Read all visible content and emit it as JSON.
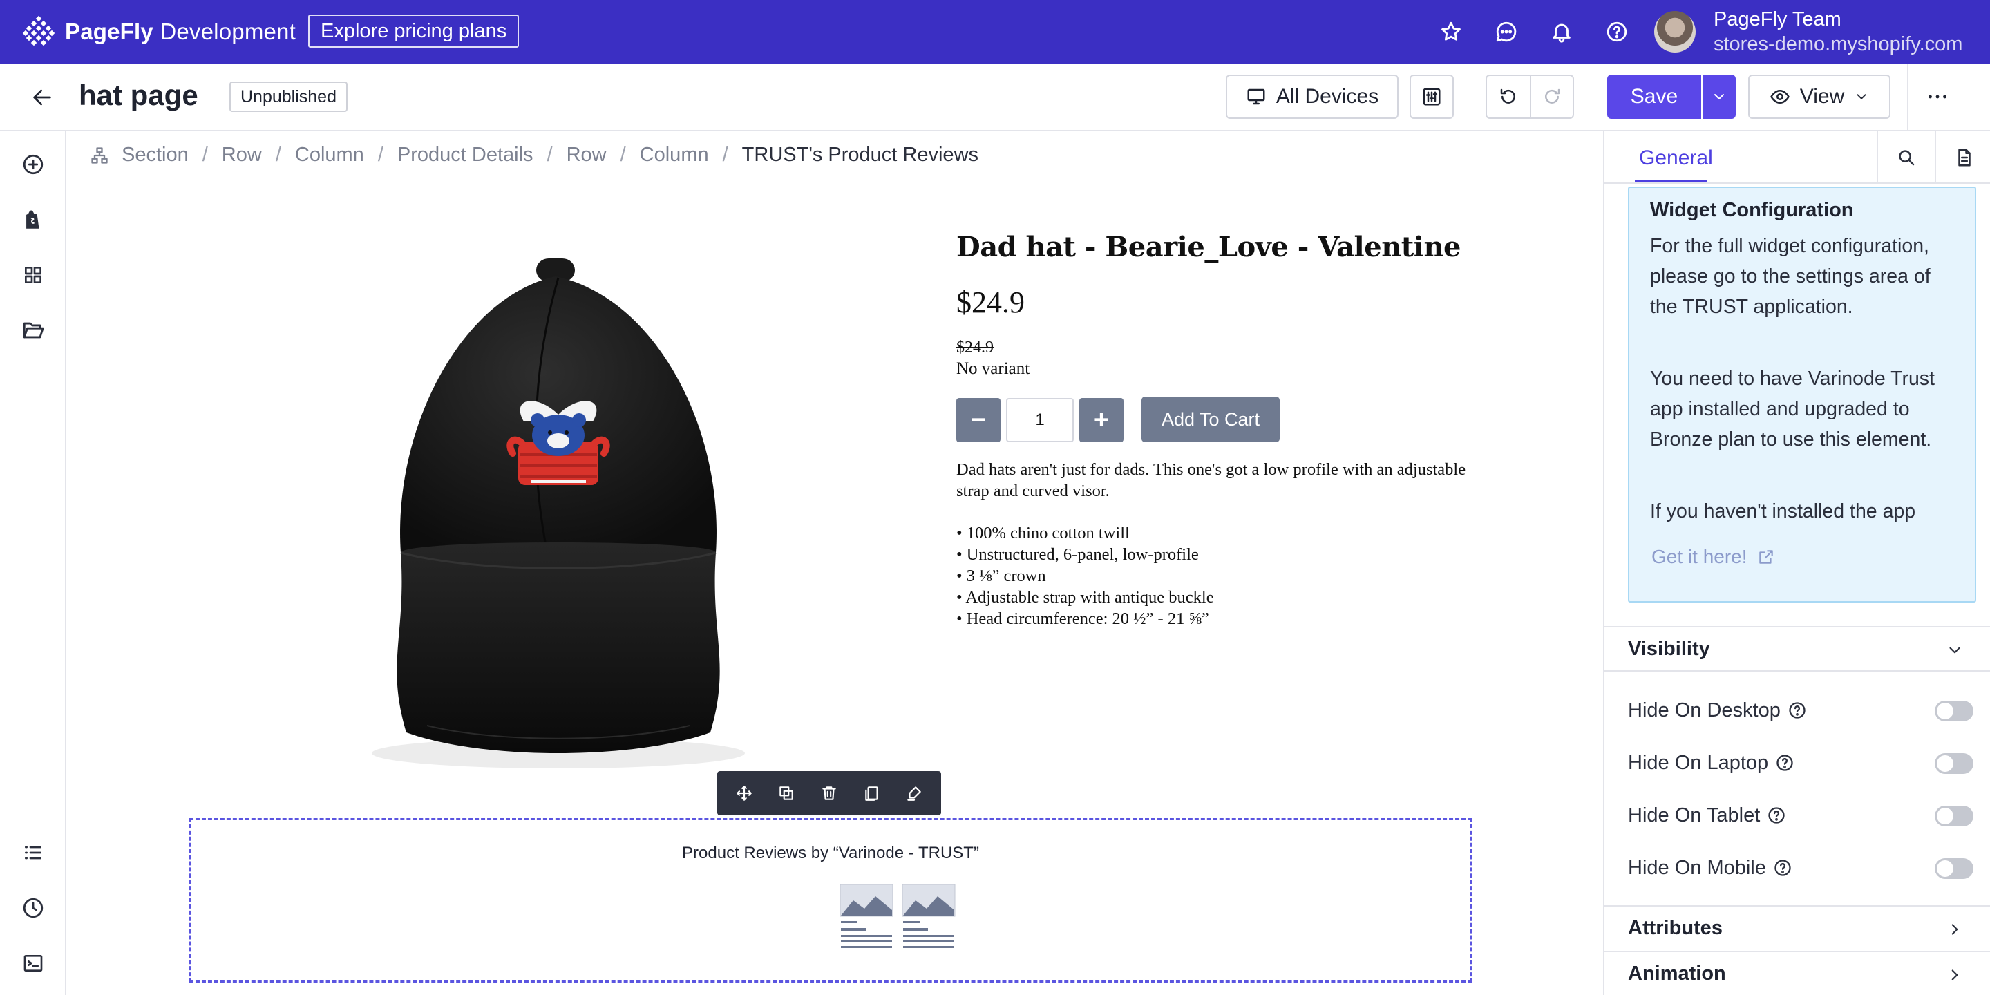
{
  "topbar": {
    "brand": "PageFly",
    "brand_suffix": "Development",
    "pricing_button": "Explore pricing plans",
    "icons": [
      "star-icon",
      "chat-icon",
      "bell-icon",
      "help-icon"
    ],
    "account_name": "PageFly Team",
    "store_url": "stores-demo.myshopify.com"
  },
  "subbar": {
    "page_title": "hat page",
    "status": "Unpublished",
    "devices_label": "All Devices",
    "save_label": "Save",
    "view_label": "View"
  },
  "breadcrumb": [
    "Section",
    "Row",
    "Column",
    "Product Details",
    "Row",
    "Column",
    "TRUST's Product Reviews"
  ],
  "product": {
    "title": "Dad hat - Bearie_Love - Valentine",
    "price": "$24.9",
    "compare_price": "$24.9",
    "variant": "No variant",
    "quantity": "1",
    "minus": "−",
    "plus": "+",
    "add_to_cart": "Add To Cart",
    "description": "Dad hats aren't just for dads. This one's got a low profile with an adjustable strap and curved visor.",
    "bullets": [
      "• 100% chino cotton twill",
      "• Unstructured, 6-panel, low-profile",
      "• 3 ⅛” crown",
      "• Adjustable strap with antique buckle",
      "• Head circumference: 20 ½” - 21 ⅝”"
    ]
  },
  "reviews_widget": {
    "title": "Product Reviews by “Varinode - TRUST”"
  },
  "right_panel": {
    "tab_general": "General",
    "widget_config": {
      "title": "Widget Configuration",
      "p1": "For the full widget configuration, please go to the settings area of the TRUST application.",
      "p2": "You need to have Varinode Trust app installed and upgraded to Bronze plan to use this element.",
      "p3": "If you haven't installed the app",
      "link": "Get it here!"
    },
    "visibility": {
      "title": "Visibility",
      "options": [
        "Hide On Desktop",
        "Hide On Laptop",
        "Hide On Tablet",
        "Hide On Mobile"
      ]
    },
    "attributes_title": "Attributes",
    "animation_title": "Animation"
  },
  "colors": {
    "brand": "#3b2fc3",
    "accent": "#5a47e8",
    "info_bg": "#e6f4fd"
  }
}
